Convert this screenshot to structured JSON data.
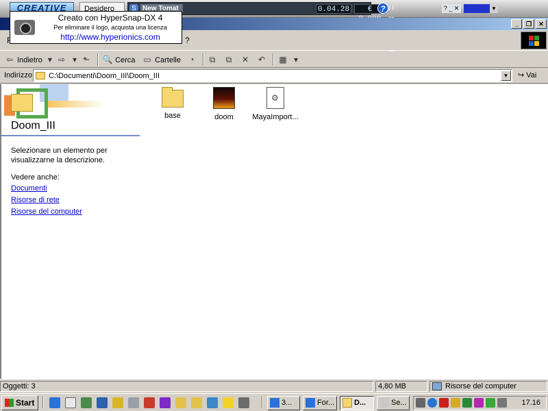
{
  "topbar": {
    "brand": "CREATIVE",
    "desktop_tab": "Desidero",
    "player_track": "New Tomat",
    "player_time": "0.04.28",
    "player_money": "€ 0,000",
    "player_controls": "ıl ✉ ⬥ ▶ ⏮",
    "player_mini": "? _ ✕",
    "help_label": "?"
  },
  "watermark": {
    "line1": "Creato con HyperSnap-DX 4",
    "line2": "Per eliminare il logo, acquista una licenza",
    "line3": "http://www.hyperionics.com"
  },
  "window": {
    "menu_visible_letter": "F",
    "menu_help": "?"
  },
  "toolbar": {
    "back": "Indietro",
    "search": "Cerca",
    "folders": "Cartelle"
  },
  "address": {
    "label": "Indirizzo",
    "path": "C:\\Documenti\\Doom_III\\Doom_III",
    "go": "Vai"
  },
  "left_pane": {
    "folder_name": "Doom_III",
    "description": "Selezionare un elemento per visualizzarne la descrizione.",
    "see_also": "Vedere anche:",
    "links": [
      "Documenti",
      "Risorse di rete",
      "Risorse del computer"
    ]
  },
  "files": [
    {
      "name": "base",
      "type": "folder",
      "selected": true
    },
    {
      "name": "doom",
      "type": "app",
      "selected": false
    },
    {
      "name": "MayaImport...",
      "type": "file",
      "selected": false
    }
  ],
  "status": {
    "objects": "Oggetti: 3",
    "size": "4,80 MB",
    "zone": "Risorse del computer"
  },
  "taskbar": {
    "start": "Start",
    "tasks": [
      "3...",
      "For...",
      "D...",
      "Se..."
    ],
    "clock": "17.16"
  },
  "colors": {
    "titlebar": "#0a246a",
    "window_bg": "#d4d0c8",
    "link": "#0000cc"
  }
}
